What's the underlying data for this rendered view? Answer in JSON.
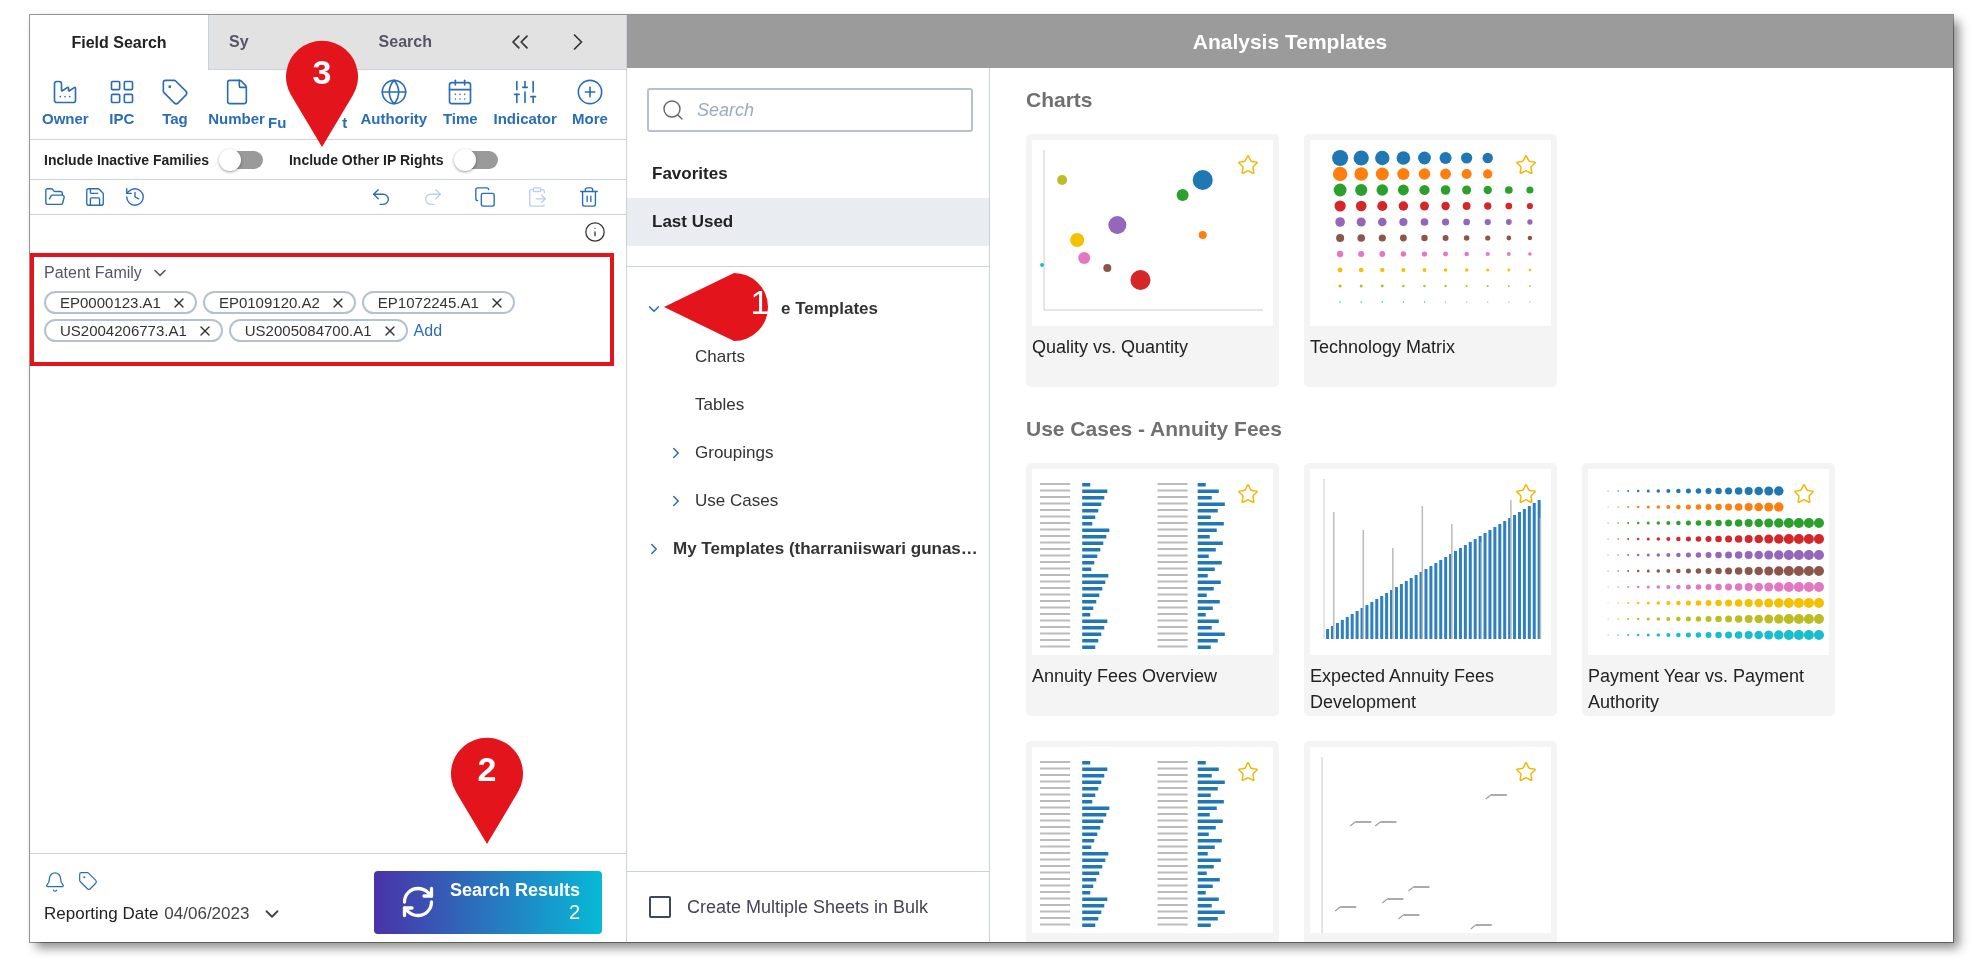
{
  "tabs": [
    {
      "parts": [
        "Field Search"
      ],
      "selected": true
    },
    {
      "parts": [
        "Sy",
        "Search"
      ],
      "selected": false
    }
  ],
  "field_tools": [
    {
      "label": "Owner"
    },
    {
      "label": "IPC"
    },
    {
      "label": "Tag"
    },
    {
      "label": "Number"
    },
    {
      "label": "Fu",
      "label_end": "t"
    },
    {
      "label": "Authority"
    },
    {
      "label": "Time"
    },
    {
      "label": "Indicator"
    },
    {
      "label": "More"
    }
  ],
  "toggles": [
    {
      "label": "Include Inactive Families",
      "on": false
    },
    {
      "label": "Include Other IP Rights",
      "on": false
    }
  ],
  "actions": [
    {
      "disabled": false
    },
    {
      "disabled": false
    },
    {
      "disabled": false
    },
    {
      "disabled": false
    },
    {
      "disabled": true
    },
    {
      "disabled": false
    },
    {
      "disabled": true
    },
    {
      "disabled": false
    }
  ],
  "patent_family": {
    "label": "Patent Family",
    "highlighted": true,
    "add_label": "Add",
    "chips": [
      "EP0000123.A1",
      "EP0109120.A2",
      "EP1072245.A1",
      "US2004206773.A1",
      "US2005084700.A1"
    ]
  },
  "footer": {
    "reporting_label": "Reporting Date",
    "reporting_date": "04/06/2023",
    "button_label": "Search Results",
    "button_count": "2"
  },
  "header_title": "Analysis Templates",
  "template_search": {
    "placeholder": "Search"
  },
  "quick_lists": [
    {
      "label": "Favorites",
      "selected": false
    },
    {
      "label": "Last Used",
      "selected": true
    }
  ],
  "tree": [
    {
      "label": "e Templates",
      "expanded": true,
      "children": [
        {
          "label": "Charts"
        },
        {
          "label": "Tables"
        },
        {
          "label": "Groupings",
          "expanded": false
        },
        {
          "label": "Use Cases",
          "expanded": false
        }
      ]
    },
    {
      "label": "My Templates (tharraniiswari gunas…",
      "expanded": false
    }
  ],
  "bulk": {
    "label": "Create Multiple Sheets in Bulk",
    "checked": false
  },
  "sections": [
    {
      "title": "Charts",
      "cards": [
        {
          "title": "Quality vs. Quantity",
          "kind": "bubble",
          "favorite": false
        },
        {
          "title": "Technology Matrix",
          "kind": "matrix",
          "favorite": false
        }
      ]
    },
    {
      "title": "Use Cases - Annuity Fees",
      "cards": [
        {
          "title": "Annuity Fees Overview",
          "kind": "table",
          "favorite": false
        },
        {
          "title": "Expected Annuity Fees Development",
          "kind": "columns",
          "favorite": false
        },
        {
          "title": "Payment Year vs. Payment Authority",
          "kind": "dots",
          "favorite": false
        },
        {
          "kind": "table",
          "favorite": false
        },
        {
          "kind": "scatter",
          "favorite": false
        }
      ]
    }
  ],
  "callouts": [
    {
      "number": "3",
      "kind": "down"
    },
    {
      "number": "1",
      "kind": "left"
    },
    {
      "number": "2",
      "kind": "down"
    }
  ]
}
